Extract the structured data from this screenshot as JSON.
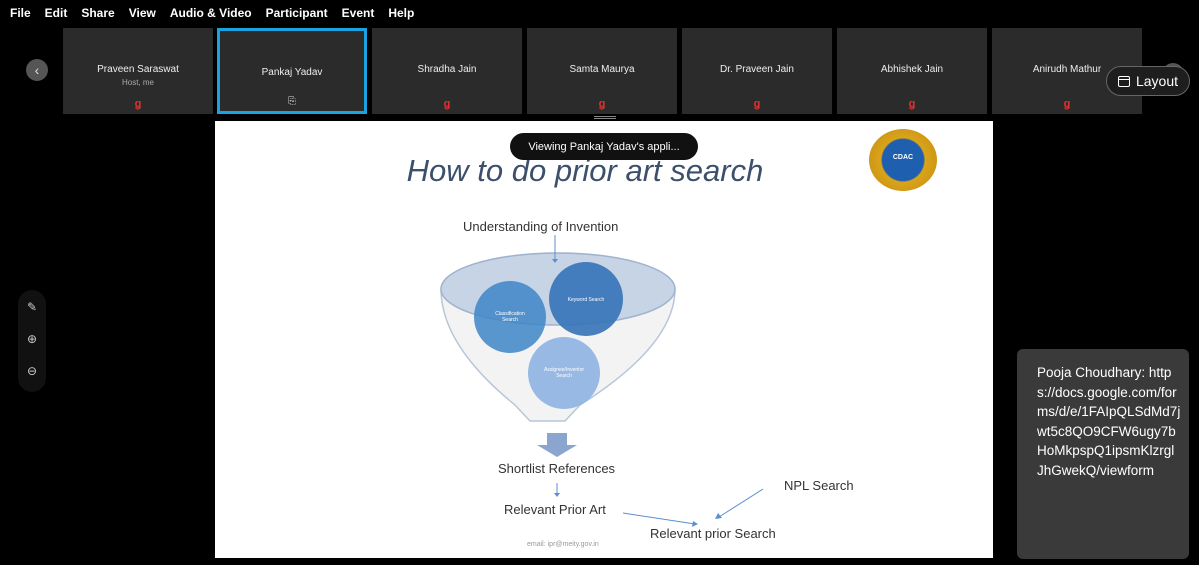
{
  "menu": [
    "File",
    "Edit",
    "Share",
    "View",
    "Audio & Video",
    "Participant",
    "Event",
    "Help"
  ],
  "participants": [
    {
      "name": "Praveen Saraswat",
      "role": "Host, me",
      "status": "mic-muted"
    },
    {
      "name": "Pankaj Yadav",
      "role": "",
      "status": "sharing"
    },
    {
      "name": "Shradha Jain",
      "role": "",
      "status": "mic-muted"
    },
    {
      "name": "Samta Maurya",
      "role": "",
      "status": "mic-muted"
    },
    {
      "name": "Dr. Praveen Jain",
      "role": "",
      "status": "mic-muted"
    },
    {
      "name": "Abhishek Jain",
      "role": "",
      "status": "mic-muted"
    },
    {
      "name": "Anirudh Mathur",
      "role": "",
      "status": "mic-muted"
    }
  ],
  "layout_button": "Layout",
  "toast": "Viewing Pankaj Yadav's appli...",
  "slide": {
    "title": "How to do prior art search",
    "logo_text": "CDAC",
    "understanding": "Understanding of Invention",
    "keyword": "Keyword Search",
    "classification": "Classification Search",
    "assignee": "Assignee/Inventor Search",
    "shortlist": "Shortlist References",
    "relevant_prior_art": "Relevant Prior Art",
    "npl": "NPL Search",
    "relevant_prior_search": "Relevant prior Search",
    "footer": "email: ipr@meity.gov.in"
  },
  "icons": {
    "mic": "mic-muted-icon",
    "share": "share-screen-icon",
    "annotate": "pen-icon",
    "zoom_in": "zoom-in-icon",
    "zoom_out": "zoom-out-icon"
  },
  "chat": {
    "text": "Pooja Choudhary: https://docs.google.com/forms/d/e/1FAIpQLSdMd7jwt5c8QO9CFW6ugy7bHoMkpspQ1ipsmKlzrglJhGwekQ/viewform"
  },
  "colors": {
    "active_border": "#1aa3e0",
    "muted_mic": "#e0312f",
    "circle_blue": "#3d85c6"
  }
}
